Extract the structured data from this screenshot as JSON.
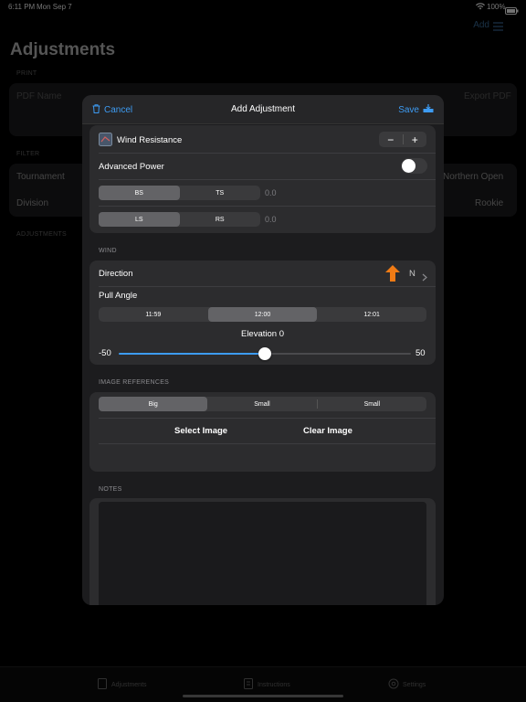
{
  "status_bar": {
    "time": "6:11 PM",
    "date": "Mon Sep 7",
    "battery": "100%"
  },
  "background": {
    "title": "Adjustments",
    "add_label": "Add",
    "print_section": "PRINT",
    "pdf_name_placeholder": "PDF Name",
    "export_pdf_label": "Export PDF",
    "filter_section": "FILTER",
    "tournament_label": "Tournament",
    "tournament_value": "Northern Open",
    "division_label": "Division",
    "division_value": "Rookie",
    "adjustments_section": "ADJUSTMENTS",
    "tabs": [
      {
        "label": "Adjustments"
      },
      {
        "label": "Instructions"
      },
      {
        "label": "Settings"
      }
    ]
  },
  "modal": {
    "title": "Add Adjustment",
    "cancel_label": "Cancel",
    "save_label": "Save",
    "wind_resistance_label": "Wind Resistance",
    "stepper_minus": "−",
    "stepper_plus": "+",
    "advanced_power_label": "Advanced Power",
    "advanced_power_on": false,
    "seg1": {
      "options": [
        "BS",
        "TS"
      ],
      "selected": 0,
      "value": "0.0"
    },
    "seg2": {
      "options": [
        "LS",
        "RS"
      ],
      "selected": 0,
      "value": "0.0"
    },
    "wind_section": "WIND",
    "direction_label": "Direction",
    "direction_value": "N",
    "pull_angle_label": "Pull Angle",
    "pull_angle_options": [
      "11:59",
      "12:00",
      "12:01"
    ],
    "pull_angle_selected": 1,
    "elevation_label": "Elevation 0",
    "slider_min": "-50",
    "slider_max": "50",
    "slider_value": 0,
    "image_section": "IMAGE REFERENCES",
    "image_options": [
      "Big",
      "Small",
      "Small"
    ],
    "image_selected": 0,
    "select_image_label": "Select Image",
    "clear_image_label": "Clear Image",
    "notes_section": "NOTES",
    "notes_value": ""
  },
  "colors": {
    "accent": "#3d9bf2",
    "arrow": "#f07b15"
  }
}
